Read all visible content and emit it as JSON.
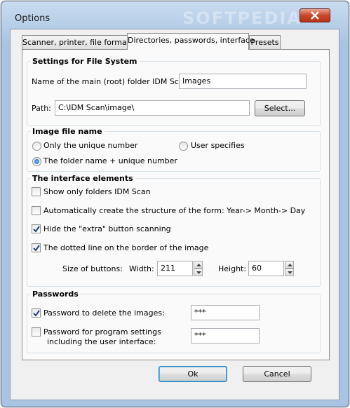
{
  "window": {
    "title": "Options",
    "watermark": "SOFTPEDIA"
  },
  "tabs": [
    {
      "label": "Scanner, printer, file formats"
    },
    {
      "label": "Directories, passwords, interface"
    },
    {
      "label": "Presets"
    }
  ],
  "file_system": {
    "title": "Settings for File System",
    "root_label": "Name of the main (root) folder IDM Scan:",
    "root_value": "Images",
    "path_label": "Path:",
    "path_value": "C:\\IDM Scan\\image\\",
    "select_button": "Select..."
  },
  "image_name": {
    "title": "Image file name",
    "options": [
      {
        "label": "Only the unique number",
        "selected": false
      },
      {
        "label": "User specifies",
        "selected": false
      },
      {
        "label": "The folder name + unique number",
        "selected": true
      }
    ]
  },
  "interface": {
    "title": "The interface elements",
    "checks": [
      {
        "label": "Show only folders IDM Scan",
        "checked": false
      },
      {
        "label": "Automatically create the structure of the form: Year-> Month-> Day",
        "checked": false
      },
      {
        "label": "Hide the \"extra\" button scanning",
        "checked": true
      },
      {
        "label": "The dotted line on the border of the image",
        "checked": true
      }
    ],
    "size_label": "Size of buttons:",
    "width_label": "Width:",
    "width_value": "211",
    "height_label": "Height:",
    "height_value": "60"
  },
  "passwords": {
    "title": "Passwords",
    "delete_label": "Password to delete the images:",
    "delete_value": "***",
    "delete_checked": true,
    "settings_label_1": "Password for program settings",
    "settings_label_2": "including the user interface:",
    "settings_value": "***",
    "settings_checked": false
  },
  "footer": {
    "ok": "Ok",
    "cancel": "Cancel"
  }
}
